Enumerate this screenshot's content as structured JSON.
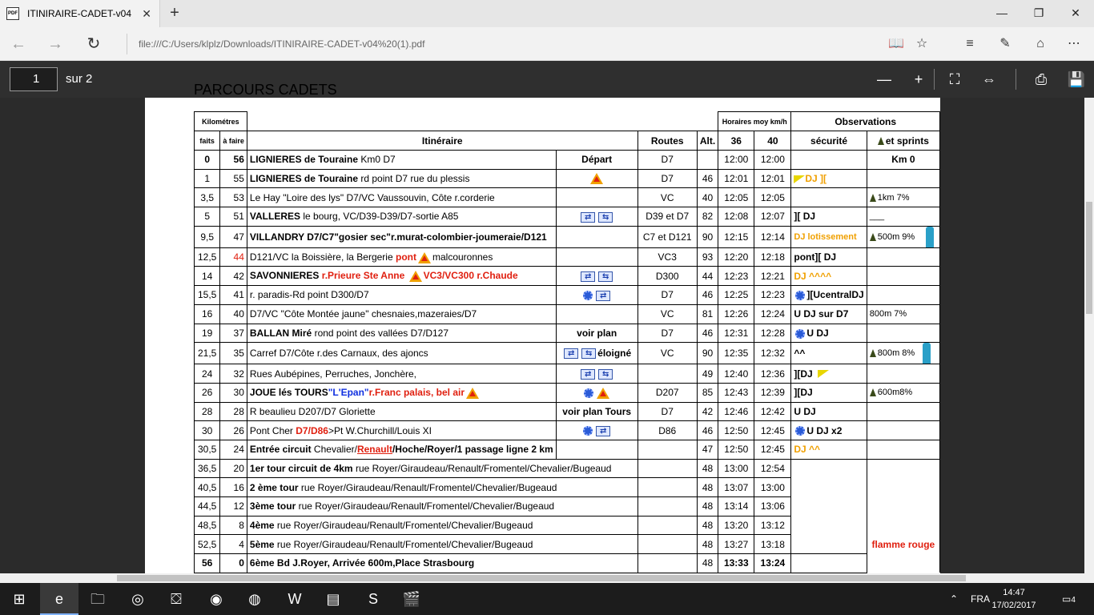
{
  "browser": {
    "tab_title": "ITINIRAIRE-CADET-v04",
    "tab_close": "✕",
    "new_tab": "+",
    "address": "file:///C:/Users/klplz/Downloads/ITINIRAIRE-CADET-v04%20(1).pdf"
  },
  "pdf_toolbar": {
    "page_number": "1",
    "page_of": "sur 2"
  },
  "document": {
    "title": "PARCOURS CADETS",
    "headers": {
      "km": "Kilométres",
      "horaires": "Horaires moy km/h",
      "observations": "Observations",
      "faits": "faits",
      "a_faire": "à faire",
      "itineraire": "Itinéraire",
      "routes": "Routes",
      "alt": "Alt.",
      "h36": "36",
      "h40": "40",
      "securite": "sécurité",
      "sprints": "et sprints"
    },
    "rows": [
      {
        "faits": "0",
        "afaire": "56",
        "it_bold": "LIGNIERES de Touraine",
        "it_rest": " Km0 D7",
        "note": "Départ",
        "route": "D7",
        "alt": "",
        "t36": "12:00",
        "t40": "12:00",
        "sec": "",
        "spr": "Km 0"
      },
      {
        "faits": "1",
        "afaire": "55",
        "it_bold": "LIGNIERES de Touraine",
        "it_rest": " rd point D7 rue du plessis",
        "note": "",
        "route": "D7",
        "alt": "46",
        "t36": "12:01",
        "t40": "12:01",
        "sec": "DJ ][",
        "spr": ""
      },
      {
        "faits": "3,5",
        "afaire": "53",
        "it_bold": "",
        "it_rest": "Le Hay \"Loire des lys\" D7/VC Vaussouvin, Côte r.corderie",
        "note": "",
        "route": "VC",
        "alt": "40",
        "t36": "12:05",
        "t40": "12:05",
        "sec": "",
        "spr": "1km 7%"
      },
      {
        "faits": "5",
        "afaire": "51",
        "it_bold": "VALLERES",
        "it_rest": " le bourg, VC/D39-D39/D7-sortie A85",
        "note": "",
        "route": "D39 et D7",
        "alt": "82",
        "t36": "12:08",
        "t40": "12:07",
        "sec": "][ DJ",
        "spr": "___"
      },
      {
        "faits": "9,5",
        "afaire": "47",
        "it_bold": "VILLANDRY D7/C7\"gosier sec\"r.murat-colombier-joumeraie/D121",
        "it_rest": "",
        "note": "",
        "route": "C7 et D121",
        "alt": "90",
        "t36": "12:15",
        "t40": "12:14",
        "sec": "DJ lotissement",
        "spr": "500m 9%"
      },
      {
        "faits": "12,5",
        "afaire": "44",
        "it_bold": "",
        "it_rest": "D121/VC la Boissière, la Bergerie ",
        "it_red": "pont",
        "it_tail": "malcouronnes",
        "note": "",
        "route": "VC3",
        "alt": "93",
        "t36": "12:20",
        "t40": "12:18",
        "sec": "pont][ DJ",
        "spr": ""
      },
      {
        "faits": "14",
        "afaire": "42",
        "it_bold": "SAVONNIERES",
        "it_red": " r.Prieure Ste Anne ",
        "it_red2": "VC3/VC300 r.Chaude",
        "note": "",
        "route": "D300",
        "alt": "44",
        "t36": "12:23",
        "t40": "12:21",
        "sec": "DJ ^^^^",
        "spr": ""
      },
      {
        "faits": "15,5",
        "afaire": "41",
        "it_bold": "",
        "it_rest": "r. paradis-Rd point D300/D7",
        "note": "",
        "route": "D7",
        "alt": "46",
        "t36": "12:25",
        "t40": "12:23",
        "sec": "][UcentralDJ",
        "spr": ""
      },
      {
        "faits": "16",
        "afaire": "40",
        "it_bold": "",
        "it_rest": "D7/VC \"Côte Montée jaune\" chesnaies,mazeraies/D7",
        "note": "",
        "route": "VC",
        "alt": "81",
        "t36": "12:26",
        "t40": "12:24",
        "sec": "U DJ sur D7",
        "spr": "800m 7%"
      },
      {
        "faits": "19",
        "afaire": "37",
        "it_bold": "BALLAN Miré",
        "it_rest": " rond point des vallées D7/D127",
        "note": "voir plan",
        "route": "D7",
        "alt": "46",
        "t36": "12:31",
        "t40": "12:28",
        "sec": "U DJ",
        "spr": ""
      },
      {
        "faits": "21,5",
        "afaire": "35",
        "it_bold": "",
        "it_rest": "Carref D7/Côte r.des Carnaux, des ajoncs",
        "note": "éloigné",
        "route": "VC",
        "alt": "90",
        "t36": "12:35",
        "t40": "12:32",
        "sec": "^^",
        "spr": "800m 8%"
      },
      {
        "faits": "24",
        "afaire": "32",
        "it_bold": "",
        "it_rest": "Rues Aubépines, Perruches, Jonchère,",
        "note": "",
        "route": "",
        "alt": "49",
        "t36": "12:40",
        "t40": "12:36",
        "sec": "][DJ",
        "spr": ""
      },
      {
        "faits": "26",
        "afaire": "30",
        "it_bold": "JOUE lés TOURS",
        "it_blue": "\"L'Epan\"",
        "it_red": "r.Franc palais, bel air",
        "note": "",
        "route": "D207",
        "alt": "85",
        "t36": "12:43",
        "t40": "12:39",
        "sec": "][DJ",
        "spr": "600m8%"
      },
      {
        "faits": "28",
        "afaire": "28",
        "it_bold": "",
        "it_rest": "R beaulieu D207/D7 Gloriette",
        "note": "voir plan Tours",
        "route": "D7",
        "alt": "42",
        "t36": "12:46",
        "t40": "12:42",
        "sec": "U DJ",
        "spr": ""
      },
      {
        "faits": "30",
        "afaire": "26",
        "it_bold": "",
        "it_rest": "Pont Cher ",
        "it_red": "D7/D86",
        "it_tail": ">Pt W.Churchill/Louis XI",
        "note": "",
        "route": "D86",
        "alt": "46",
        "t36": "12:50",
        "t40": "12:45",
        "sec": "U DJ x2",
        "spr": ""
      },
      {
        "faits": "30,5",
        "afaire": "24",
        "it_bold": "Entrée circuit",
        "it_rest": " Chevalier/",
        "it_red": "Renault",
        "it_tail": "/Hoche/Royer/1 passage ligne 2 km",
        "note": "",
        "route": "",
        "alt": "47",
        "t36": "12:50",
        "t40": "12:45",
        "sec": "DJ ^^",
        "spr": ""
      },
      {
        "faits": "36,5",
        "afaire": "20",
        "it_bold": "1er tour circuit de 4km",
        "it_rest": " rue Royer/Giraudeau/Renault/Fromentel/Chevalier/Bugeaud",
        "note": "",
        "route": "",
        "alt": "48",
        "t36": "13:00",
        "t40": "12:54",
        "sec": "",
        "spr": ""
      },
      {
        "faits": "40,5",
        "afaire": "16",
        "it_bold": "2 ème tour",
        "it_rest": " rue Royer/Giraudeau/Renault/Fromentel/Chevalier/Bugeaud",
        "note": "",
        "route": "",
        "alt": "48",
        "t36": "13:07",
        "t40": "13:00",
        "sec": "",
        "spr": ""
      },
      {
        "faits": "44,5",
        "afaire": "12",
        "it_bold": "3ème tour",
        "it_rest": " rue Royer/Giraudeau/Renault/Fromentel/Chevalier/Bugeaud",
        "note": "",
        "route": "",
        "alt": "48",
        "t36": "13:14",
        "t40": "13:06",
        "sec": "",
        "spr": ""
      },
      {
        "faits": "48,5",
        "afaire": "8",
        "it_bold": "4ème",
        "it_rest": " rue Royer/Giraudeau/Renault/Fromentel/Chevalier/Bugeaud",
        "note": "",
        "route": "",
        "alt": "48",
        "t36": "13:20",
        "t40": "13:12",
        "sec": "",
        "spr": ""
      },
      {
        "faits": "52,5",
        "afaire": "4",
        "it_bold": "5ème",
        "it_rest": " rue Royer/Giraudeau/Renault/Fromentel/Chevalier/Bugeaud",
        "note": "",
        "route": "",
        "alt": "48",
        "t36": "13:27",
        "t40": "13:18",
        "sec": "",
        "spr": "flamme rouge"
      },
      {
        "faits": "56",
        "afaire": "0",
        "it_bold": "6ème Bd J.Royer, Arrivée 600m,Place Strasbourg",
        "it_rest": "",
        "note": "",
        "route": "",
        "alt": "48",
        "t36": "13:33",
        "t40": "13:24",
        "sec": "",
        "spr": ""
      }
    ]
  },
  "taskbar": {
    "lang": "FRA",
    "time": "14:47",
    "date": "17/02/2017",
    "notif_count": "4"
  },
  "colors": {
    "accent_red": "#e02010",
    "accent_orange": "#f0a000",
    "accent_blue": "#1030e0",
    "taskbar_bg": "#1c1c1c",
    "pdf_toolbar_bg": "#282828"
  }
}
